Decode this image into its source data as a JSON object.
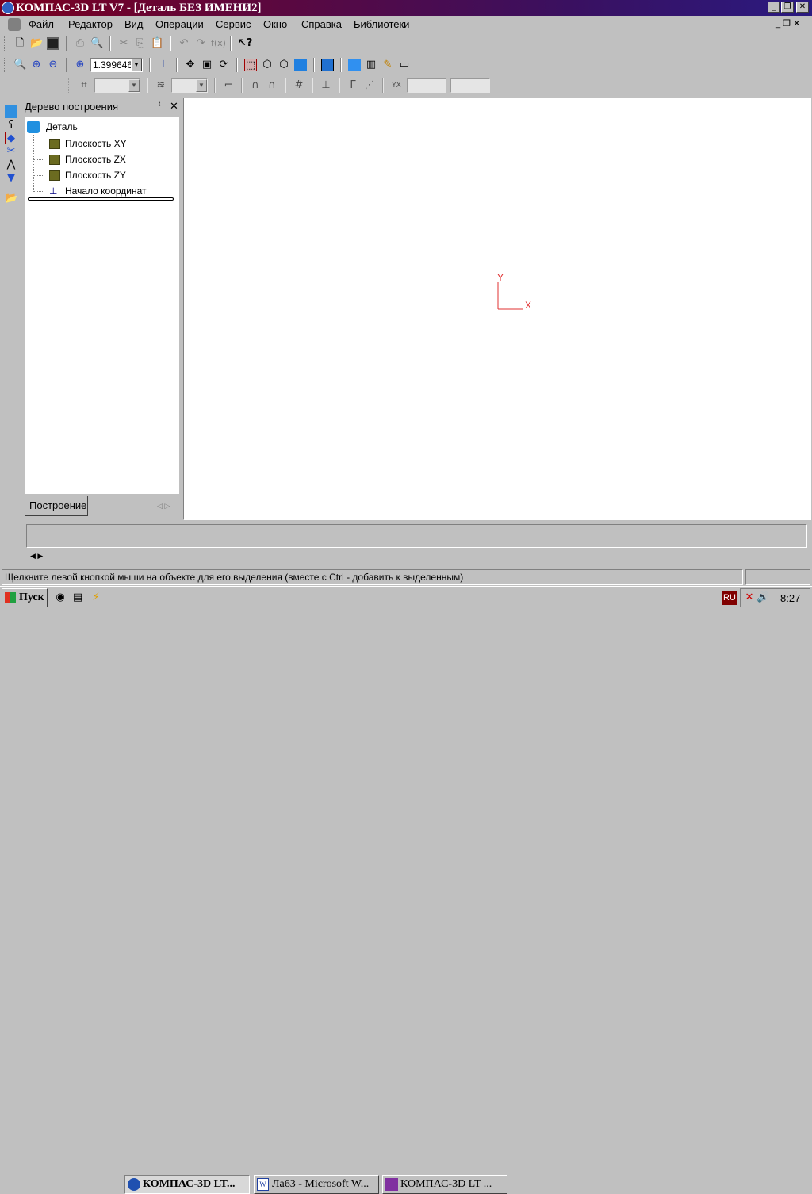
{
  "window": {
    "title": "КОМПАС-3D LT V7 - [Деталь БЕЗ ИМЕНИ2]",
    "min": "_",
    "restore": "❐",
    "close": "✕"
  },
  "menu": [
    "Файл",
    "Редактор",
    "Вид",
    "Операции",
    "Сервис",
    "Окно",
    "Справка",
    "Библиотеки"
  ],
  "toolbar": {
    "zoom_value": "1.399646"
  },
  "tree": {
    "title": "Дерево построения",
    "root": "Деталь",
    "items": [
      "Плоскость XY",
      "Плоскость ZX",
      "Плоскость ZY",
      "Начало координат"
    ],
    "tab": "Построение"
  },
  "canvas": {
    "axis_x": "X",
    "axis_y": "Y",
    "axis_color": "#e03030"
  },
  "status": {
    "message": "Щелкните левой кнопкой мыши на объекте для его выделения (вместе с Ctrl - добавить к выделенным)"
  },
  "taskbar": {
    "start": "Пуск",
    "tasks": [
      "КОМПАС-3D LT...",
      "Ла63 - Microsoft W...",
      "КОМПАС-3D LT ..."
    ],
    "lang": "RU",
    "clock": "8:27"
  }
}
